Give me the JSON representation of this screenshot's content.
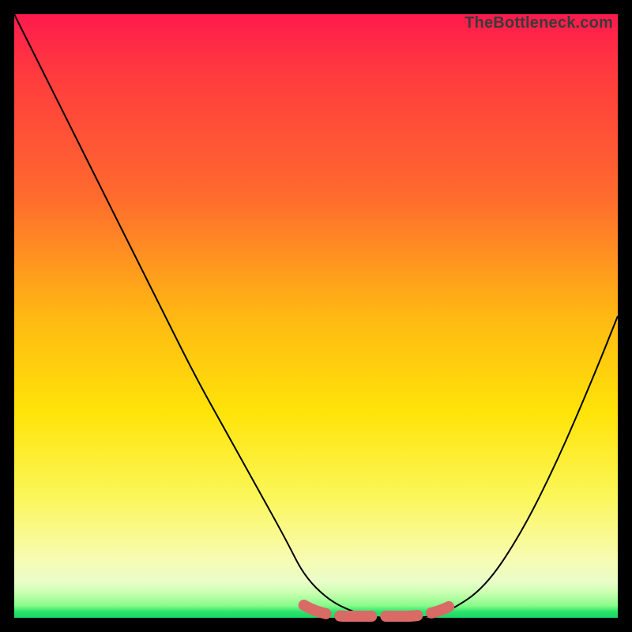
{
  "watermark": "TheBottleneck.com",
  "colors": {
    "background": "#000000",
    "gradient_top": "#ff1a4d",
    "gradient_bottom": "#17d765",
    "curve": "#000000",
    "flat_marker": "#d96a66"
  },
  "chart_data": {
    "type": "line",
    "title": "",
    "xlabel": "",
    "ylabel": "",
    "xlim": [
      0,
      100
    ],
    "ylim": [
      0,
      100
    ],
    "grid": false,
    "legend": false,
    "series": [
      {
        "name": "bottleneck-curve",
        "x": [
          0,
          5,
          10,
          15,
          20,
          25,
          30,
          35,
          40,
          45,
          48,
          52,
          56,
          60,
          64,
          68,
          72,
          78,
          84,
          90,
          96,
          100
        ],
        "y": [
          100,
          90,
          80,
          70,
          60,
          50,
          40,
          31,
          22,
          13,
          7,
          3,
          1,
          0,
          0,
          0,
          1,
          5,
          14,
          26,
          40,
          50
        ]
      }
    ],
    "annotations": [
      {
        "name": "optimal-flat-region",
        "style": "dashed-pill",
        "color": "#d96a66",
        "x_range": [
          48,
          72
        ],
        "y": 0
      }
    ],
    "background_gradient": {
      "direction": "vertical",
      "stops": [
        {
          "pos": 0.0,
          "color": "#ff1a4d"
        },
        {
          "pos": 0.3,
          "color": "#ff6a2e"
        },
        {
          "pos": 0.5,
          "color": "#ffb813"
        },
        {
          "pos": 0.8,
          "color": "#fbf75a"
        },
        {
          "pos": 0.96,
          "color": "#c7ffaf"
        },
        {
          "pos": 1.0,
          "color": "#17d765"
        }
      ]
    }
  }
}
